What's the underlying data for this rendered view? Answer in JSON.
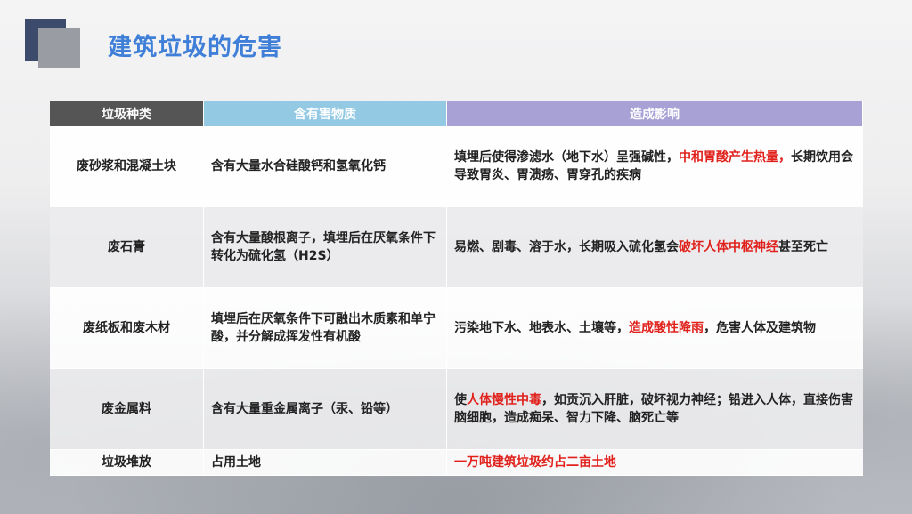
{
  "slide": {
    "title": "建筑垃圾的危害"
  },
  "table": {
    "headers": [
      "垃圾种类",
      "含有害物质",
      "造成影响"
    ],
    "rows": [
      {
        "type": "废砂浆和混凝土块",
        "substance": "含有大量水合硅酸钙和氢氧化钙",
        "effect_pre": "填埋后使得渗滤水（地下水）呈强碱性，",
        "effect_hl": "中和胃酸产生热量，",
        "effect_post": "长期饮用会导致胃炎、胃溃疡、胃穿孔的疾病"
      },
      {
        "type": "废石膏",
        "substance": "含有大量酸根离子，填埋后在厌氧条件下转化为硫化氢（H2S）",
        "effect_pre": "易燃、剧毒、溶于水，长期吸入硫化氢会",
        "effect_hl": "破坏人体中枢神经",
        "effect_post": "甚至死亡"
      },
      {
        "type": "废纸板和废木材",
        "substance": "填埋后在厌氧条件下可融出木质素和单宁酸，并分解成挥发性有机酸",
        "effect_pre": "污染地下水、地表水、土壤等，",
        "effect_hl": "造成酸性降雨",
        "effect_post": "，危害人体及建筑物"
      },
      {
        "type": "废金属料",
        "substance": "含有大量重金属离子（汞、铅等）",
        "effect_pre": "使",
        "effect_hl": "人体慢性中毒",
        "effect_post": "，如贡沉入肝脏，破坏视力神经；铅进入人体，直接伤害脑细胞，造成痴呆、智力下降、脑死亡等"
      },
      {
        "type": "垃圾堆放",
        "substance": "占用土地",
        "effect_pre": "",
        "effect_hl": "一万吨建筑垃圾约占二亩土地",
        "effect_post": ""
      }
    ]
  },
  "colors": {
    "title": "#3f7fd8",
    "header_col1": "#555555",
    "header_col2": "#93c9e3",
    "header_col3": "#a8a1d6",
    "highlight": "#e0211c"
  }
}
